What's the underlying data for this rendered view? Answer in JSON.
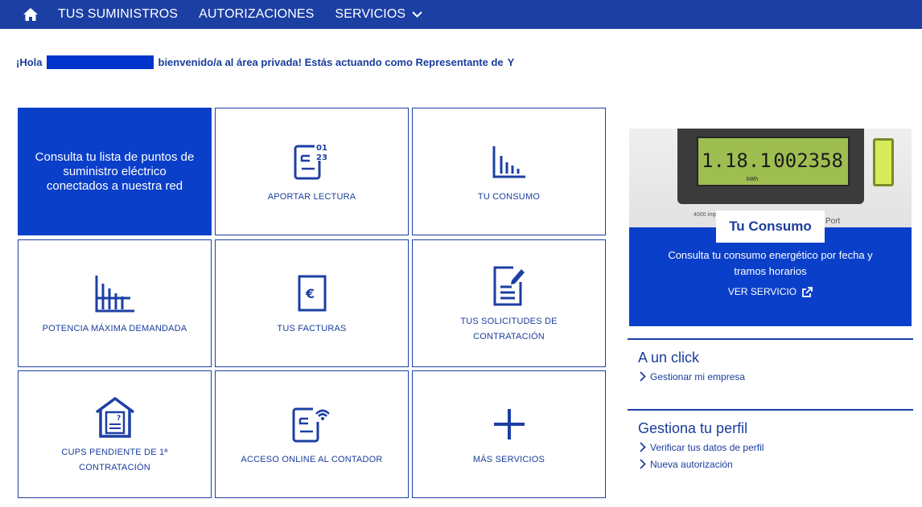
{
  "nav": {
    "home_icon": "home-icon",
    "items": [
      {
        "label": "TUS SUMINISTROS"
      },
      {
        "label": "AUTORIZACIONES"
      },
      {
        "label": "SERVICIOS"
      }
    ]
  },
  "greeting": {
    "prefix": "¡Hola",
    "suffix": "bienvenido/a al área privada! Estás actuando como Representante de",
    "tail": "Y"
  },
  "tiles": {
    "primary": "Consulta tu lista de puntos de suministro eléctrico conectados a nuestra red",
    "aportar": "APORTAR LECTURA",
    "consumo": "TU CONSUMO",
    "potencia": "POTENCIA MÁXIMA DEMANDADA",
    "facturas": "TUS FACTURAS",
    "solicitudes": "TUS SOLICITUDES DE CONTRATACIÓN",
    "cups": "CUPS PENDIENTE DE 1ª CONTRATACIÓN",
    "acceso": "ACCESO ONLINE AL CONTADOR",
    "mas": "MÁS SERVICIOS"
  },
  "promo": {
    "meter_reading_1": "1.18.1",
    "meter_reading_2": "002358",
    "meter_unit": "kWh",
    "meter_port": "Port",
    "meter_tiny": "4000 imp/kWh",
    "title": "Tu Consumo",
    "description": "Consulta tu consumo energético por fecha y tramos horarios",
    "link": "VER SERVICIO"
  },
  "quick": {
    "title": "A un click",
    "links": [
      {
        "label": "Gestionar mi empresa"
      }
    ]
  },
  "profile": {
    "title": "Gestiona tu perfil",
    "links": [
      {
        "label": "Verificar tus datos de perfil"
      },
      {
        "label": "Nueva autorización"
      }
    ]
  },
  "colors": {
    "brand": "#1c3fa4",
    "primary_tile": "#0a3fc9"
  }
}
